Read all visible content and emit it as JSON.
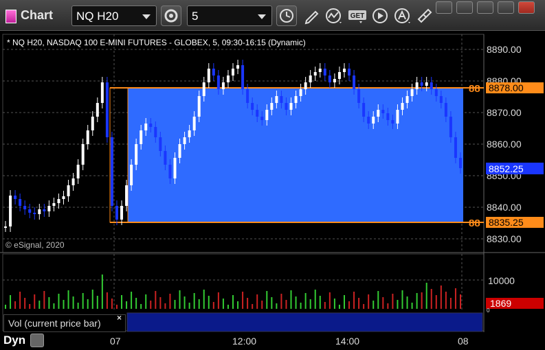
{
  "window": {
    "title": "Chart",
    "symbol": "NQ H20",
    "interval": "5"
  },
  "chart": {
    "info_line": "* NQ H20, NASDAQ 100 E-MINI FUTURES - GLOBEX, 5, 09:30-16:15 (Dynamic)",
    "copyright": "© eSignal, 2020",
    "price_labels": [
      "8890.00",
      "8880.00",
      "8870.00",
      "8860.00",
      "8850.00",
      "8840.00",
      "8830.00"
    ],
    "upper_level": {
      "tag": "88",
      "value": "8878.00"
    },
    "lower_level": {
      "tag": "88",
      "value": "8835.25"
    },
    "last_price": "8852.25",
    "time_labels": [
      "07",
      "12:00",
      "14:00",
      "08"
    ],
    "volume_label": "10000",
    "volume_last": "1869",
    "volume_unit": "0",
    "study_label": "Vol (current price bar)",
    "close_glyph": "×",
    "mode": "Dyn"
  },
  "colors": {
    "zone": "#2f6bff",
    "level_line": "#ff8c1a",
    "up": "#ffffff",
    "down": "#1a36ff",
    "vol_up": "#33cc33",
    "vol_down": "#cc2222",
    "last_tag": "#1a36ff",
    "vol_tag": "#cc0000"
  }
}
